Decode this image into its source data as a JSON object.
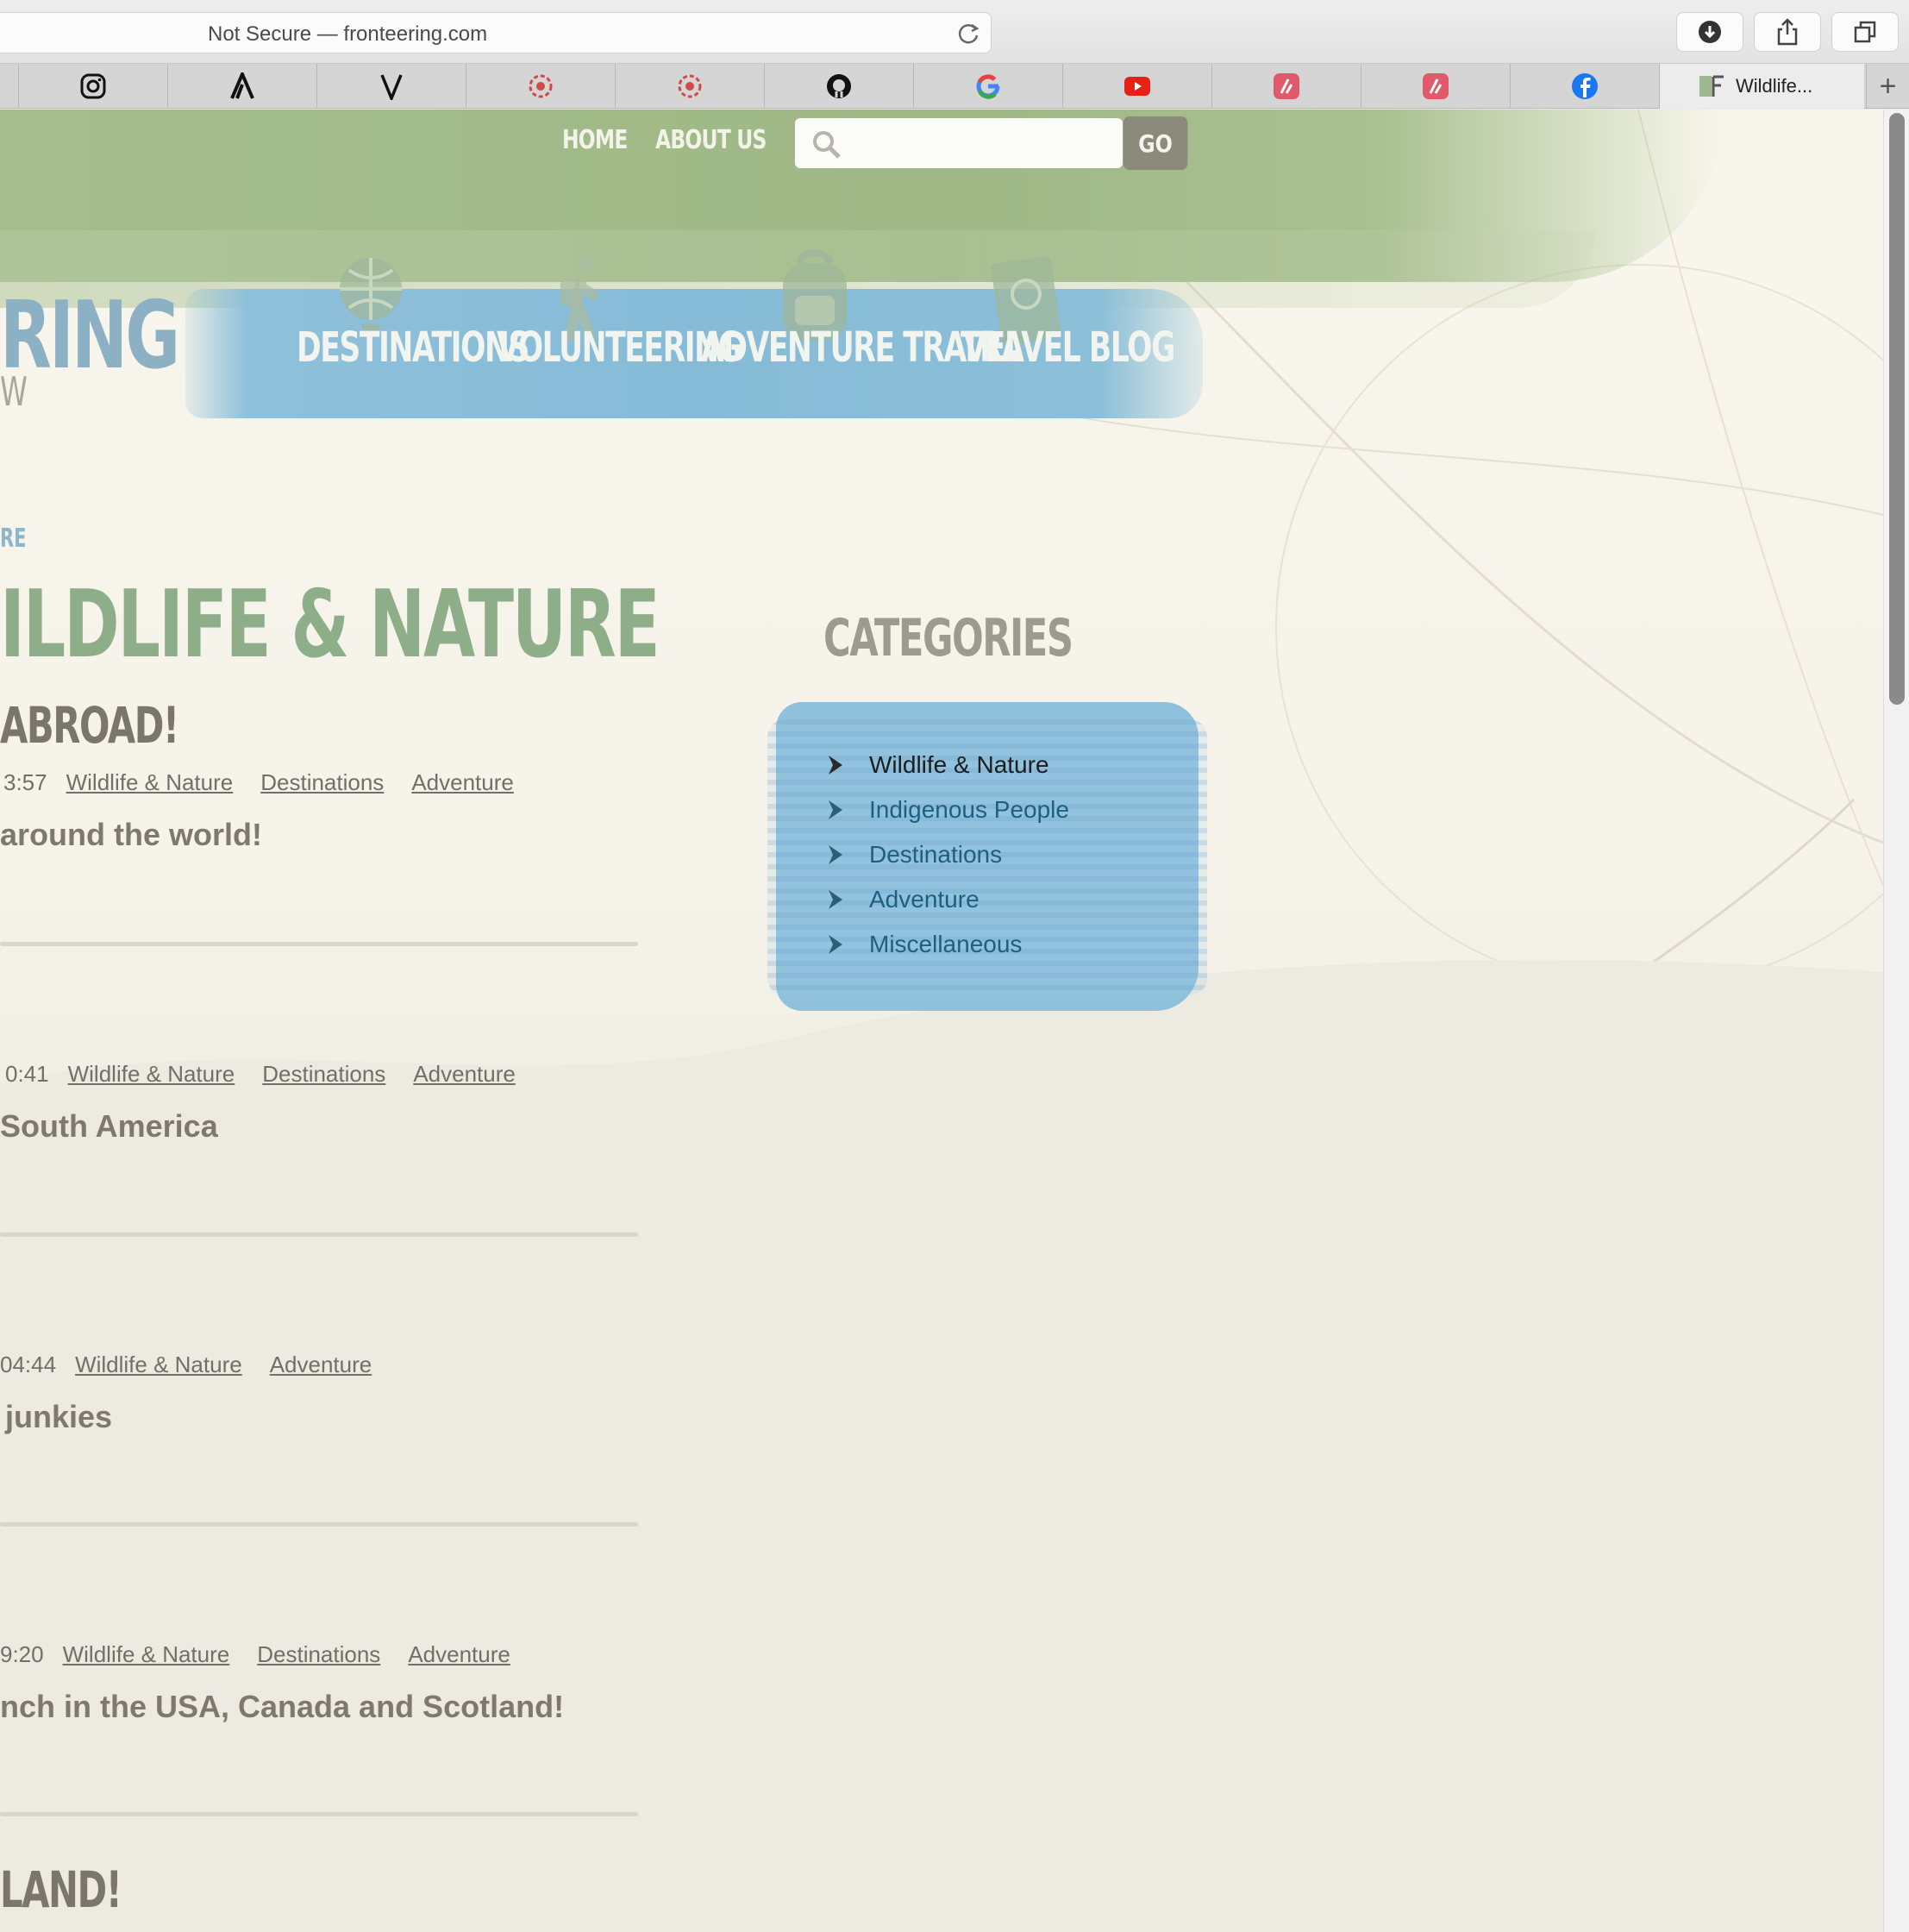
{
  "browser": {
    "address": "Not Secure — fronteering.com",
    "tabs": [
      {
        "icon": "instagram-icon"
      },
      {
        "icon": "a-letter-icon"
      },
      {
        "icon": "v-letter-icon"
      },
      {
        "icon": "red-wheel-icon"
      },
      {
        "icon": "red-wheel-icon"
      },
      {
        "icon": "github-icon"
      },
      {
        "icon": "google-icon"
      },
      {
        "icon": "youtube-icon"
      },
      {
        "icon": "red-app-icon"
      },
      {
        "icon": "red-app-icon"
      },
      {
        "icon": "facebook-icon"
      }
    ],
    "active_tab_title": "Wildlife...",
    "new_tab": "+"
  },
  "header": {
    "home": "HOME",
    "about": "ABOUT US",
    "search_placeholder": "",
    "go": "GO"
  },
  "logo": {
    "text": "RING",
    "sub": "W"
  },
  "main_nav": {
    "destinations": "DESTINATIONS",
    "volunteering": "VOLUNTEERING",
    "adventure_travel": "ADVENTURE TRAVEL",
    "travel_blog": "TRAVEL BLOG"
  },
  "breadcrumb": "RE",
  "page_title": "ILDLIFE & NATURE",
  "posts": [
    {
      "title": "ABROAD!",
      "time": "3:57",
      "tags": [
        "Wildlife & Nature",
        "Destinations",
        "Adventure"
      ],
      "excerpt": "around the world!"
    },
    {
      "title": "",
      "time": "0:41",
      "tags": [
        "Wildlife & Nature",
        "Destinations",
        "Adventure"
      ],
      "excerpt": "South America"
    },
    {
      "title": "",
      "time": "04:44",
      "tags": [
        "Wildlife & Nature",
        "Adventure"
      ],
      "excerpt": "junkies"
    },
    {
      "title": "",
      "time": "9:20",
      "tags": [
        "Wildlife & Nature",
        "Destinations",
        "Adventure"
      ],
      "excerpt": "nch in the USA, Canada and Scotland!"
    },
    {
      "title": "LAND!"
    }
  ],
  "sidebar": {
    "heading": "CATEGORIES",
    "items": [
      "Wildlife & Nature",
      "Indigenous People",
      "Destinations",
      "Adventure",
      "Miscellaneous"
    ],
    "current": "Wildlife & Nature"
  },
  "colors": {
    "green_band": "#a5bd8d",
    "blue_band": "#8fc0da",
    "title_green": "#8eae8a",
    "link_blue": "#1e5f80"
  }
}
